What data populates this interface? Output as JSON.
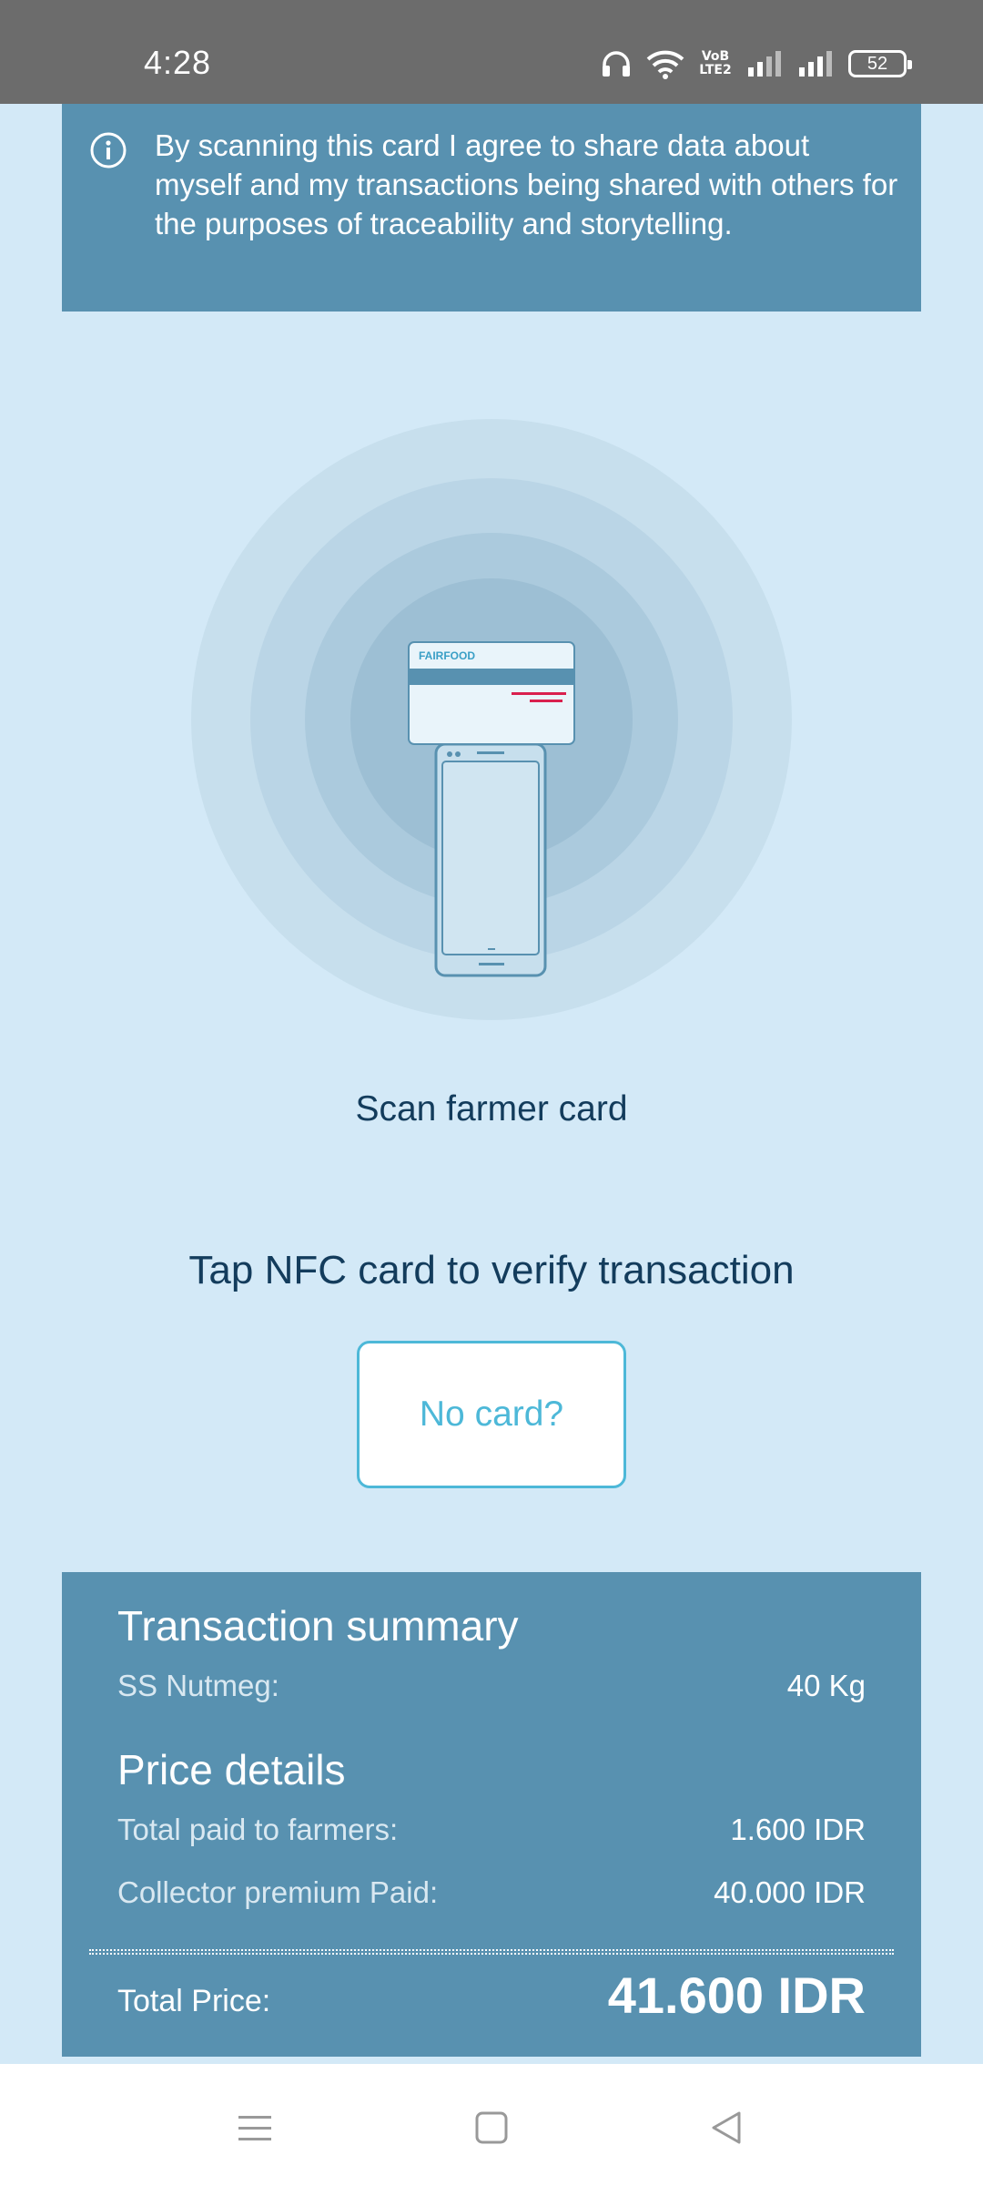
{
  "status_bar": {
    "time": "4:28",
    "volte_label": "VoB\nLTE2",
    "battery_level": "52"
  },
  "consent": {
    "text": "By scanning this card I agree to share data about myself and my transactions being shared with others for the purposes of traceability and storytelling."
  },
  "illustration": {
    "card_brand": "FAIRFOOD"
  },
  "scan": {
    "label": "Scan farmer card",
    "instruction": "Tap NFC card to verify transaction",
    "no_card_label": "No card?"
  },
  "summary": {
    "title": "Transaction summary",
    "product_label": "SS Nutmeg:",
    "product_value": "40 Kg",
    "price_title": "Price details",
    "rows": [
      {
        "label": "Total paid to farmers:",
        "value": "1.600 IDR"
      },
      {
        "label": "Collector premium Paid:",
        "value": "40.000 IDR"
      }
    ],
    "total_label": "Total Price:",
    "total_value": "41.600 IDR"
  },
  "colors": {
    "background": "#d3e9f7",
    "panel": "#5891b0",
    "accent": "#4db8d8",
    "text_dark": "#133c5c",
    "status_bar": "#6c6c6c"
  }
}
